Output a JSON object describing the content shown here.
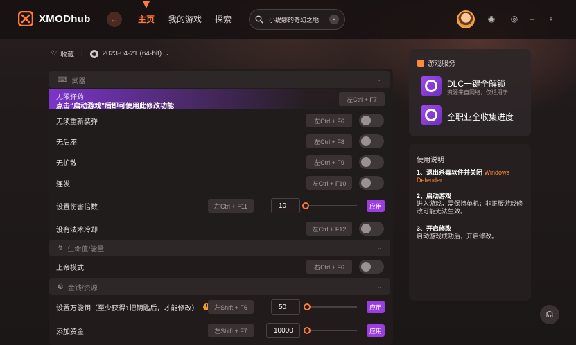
{
  "app": {
    "name": "XMODhub"
  },
  "nav": {
    "home": "主页",
    "my_games": "我的游戏",
    "explore": "探索"
  },
  "search": {
    "value": "小缇娜的奇幻之地"
  },
  "game_meta": {
    "favorite": "收藏",
    "version": "2023-04-21 (64-bit)"
  },
  "sections": {
    "weapons": "武器",
    "health": "生命值/能量",
    "money": "金钱/资源"
  },
  "cheats": {
    "infinite_ammo": {
      "label": "无限弹药",
      "notice": "点击“启动游戏”后即可使用此修改功能",
      "hotkey": "左Ctrl + F7"
    },
    "no_reload": {
      "label": "无须重新装弹",
      "hotkey": "左Ctrl + F6"
    },
    "no_recoil": {
      "label": "无后座",
      "hotkey": "左Ctrl + F8"
    },
    "no_spread": {
      "label": "无扩散",
      "hotkey": "左Ctrl + F9"
    },
    "rapid_fire": {
      "label": "连发",
      "hotkey": "左Ctrl + F10"
    },
    "damage_multiplier": {
      "label": "设置伤害倍数",
      "hotkey": "左Ctrl + F11",
      "value": "10",
      "apply": "应用"
    },
    "no_spell_cooldown": {
      "label": "没有法术冷却",
      "hotkey": "左Ctrl + F12"
    },
    "god_mode": {
      "label": "上帝模式",
      "hotkey": "右Ctrl + F6"
    },
    "skeleton_keys": {
      "label": "设置万能钥（至少获得1把钥匙后，才能修改）",
      "hotkey": "左Shift + F6",
      "value": "50",
      "apply": "应用",
      "info_glyph": "!"
    },
    "add_money": {
      "label": "添加资金",
      "hotkey": "左Shift + F7",
      "value": "10000",
      "apply": "应用"
    }
  },
  "services": {
    "title": "游戏服务",
    "dlc": {
      "name": "DLC一键全解锁",
      "sub": "资源来自网络，仅适用于..."
    },
    "save": {
      "name": "全职业全收集进度"
    }
  },
  "instructions": {
    "title": "使用说明",
    "step1_head": "1、退出杀毒软件并关闭",
    "step1_accent": "Windows Defender",
    "step2_head": "2、启动游戏",
    "step2_body": "进入游戏，需保持单机；非正版游戏修改可能无法生效。",
    "step3_head": "3、开启修改",
    "step3_body": "启动游戏成功后，开启修改。"
  },
  "colors": {
    "accent": "#ff7a3a",
    "purple": "#9b3de0"
  }
}
